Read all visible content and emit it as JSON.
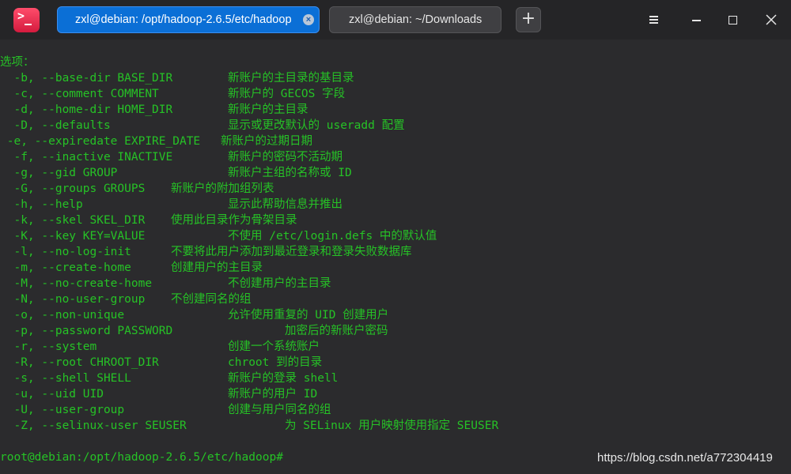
{
  "tabs": [
    {
      "label": "zxl@debian: /opt/hadoop-2.6.5/etc/hadoop",
      "active": true,
      "close": "×"
    },
    {
      "label": "zxl@debian: ~/Downloads",
      "active": false
    }
  ],
  "new_tab_label": "+",
  "icons": {
    "app": "terminal-app-icon",
    "menu": "hamburger-menu-icon",
    "minimize": "minimize-icon",
    "maximize": "maximize-icon",
    "close": "close-icon"
  },
  "colors": {
    "terminal_text": "#26c226",
    "active_tab": "#0b6fd6",
    "background": "#2b2b2d"
  },
  "terminal": {
    "header": "选项：",
    "options": [
      {
        "flag": "  -b, --base-dir BASE_DIR",
        "desc": "新账户的主目录的基目录"
      },
      {
        "flag": "  -c, --comment COMMENT",
        "desc": "新账户的 GECOS 字段"
      },
      {
        "flag": "  -d, --home-dir HOME_DIR",
        "desc": "新账户的主目录"
      },
      {
        "flag": "  -D, --defaults",
        "desc": "显示或更改默认的 useradd 配置"
      },
      {
        "flag": " -e, --expiredate EXPIRE_DATE",
        "desc": "新账户的过期日期"
      },
      {
        "flag": "  -f, --inactive INACTIVE",
        "desc": "新账户的密码不活动期"
      },
      {
        "flag": "  -g, --gid GROUP",
        "desc": "新账户主组的名称或 ID"
      },
      {
        "flag": "  -G, --groups GROUPS",
        "desc": "新账户的附加组列表"
      },
      {
        "flag": "  -h, --help",
        "desc": "显示此帮助信息并推出"
      },
      {
        "flag": "  -k, --skel SKEL_DIR",
        "desc": "使用此目录作为骨架目录"
      },
      {
        "flag": "  -K, --key KEY=VALUE",
        "desc": "不使用 /etc/login.defs 中的默认值"
      },
      {
        "flag": "  -l, --no-log-init",
        "desc": "不要将此用户添加到最近登录和登录失败数据库"
      },
      {
        "flag": "  -m, --create-home",
        "desc": "创建用户的主目录"
      },
      {
        "flag": "  -M, --no-create-home",
        "desc": "不创建用户的主目录"
      },
      {
        "flag": "  -N, --no-user-group",
        "desc": "不创建同名的组"
      },
      {
        "flag": "  -o, --non-unique",
        "desc": "允许使用重复的 UID 创建用户"
      },
      {
        "flag": "  -p, --password PASSWORD",
        "desc": "加密后的新账户密码"
      },
      {
        "flag": "  -r, --system",
        "desc": "创建一个系统账户"
      },
      {
        "flag": "  -R, --root CHROOT_DIR",
        "desc": "chroot 到的目录"
      },
      {
        "flag": "  -s, --shell SHELL",
        "desc": "新账户的登录 shell"
      },
      {
        "flag": "  -u, --uid UID",
        "desc": "新账户的用户 ID"
      },
      {
        "flag": "  -U, --user-group",
        "desc": "创建与用户同名的组"
      },
      {
        "flag": "  -Z, --selinux-user SEUSER",
        "desc": "为 SELinux 用户映射使用指定 SEUSER"
      }
    ],
    "prompt": "root@debian:/opt/hadoop-2.6.5/etc/hadoop# "
  },
  "watermark": "https://blog.csdn.net/a772304419"
}
